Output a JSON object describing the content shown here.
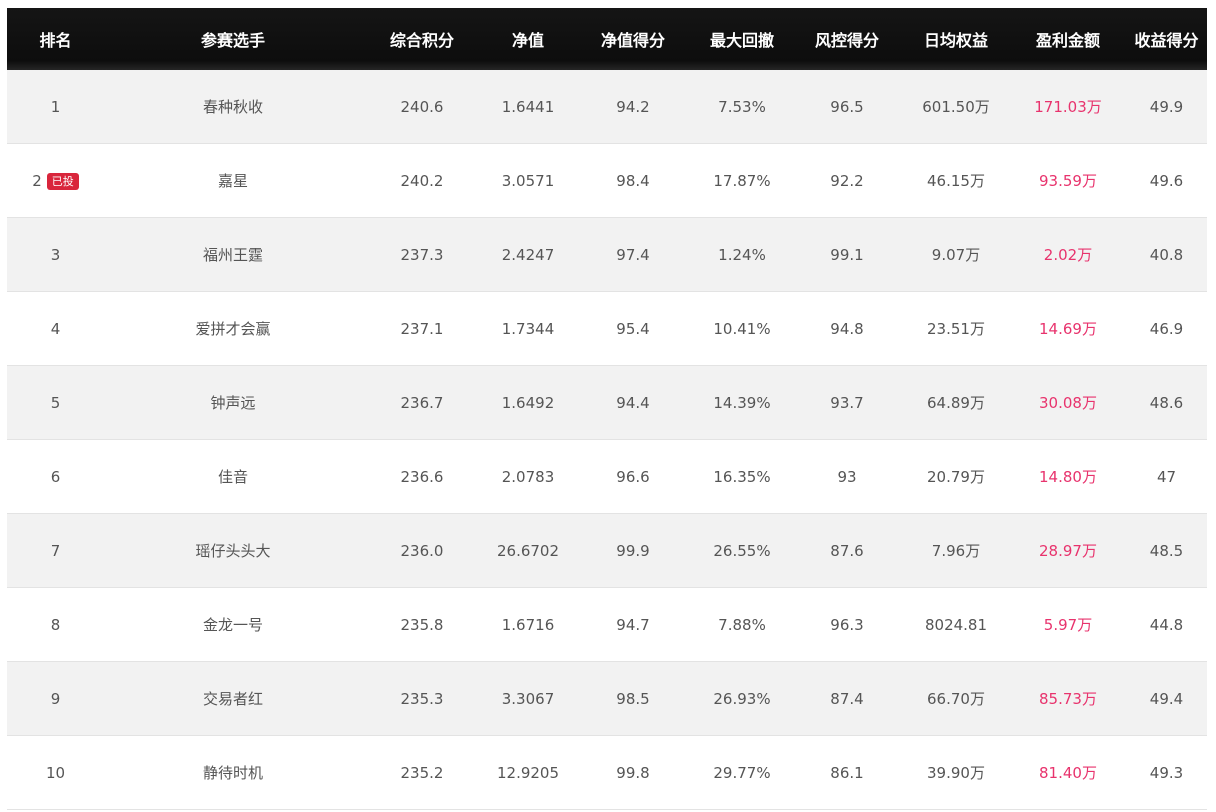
{
  "table": {
    "headers": [
      "排名",
      "参赛选手",
      "综合积分",
      "净值",
      "净值得分",
      "最大回撤",
      "风控得分",
      "日均权益",
      "盈利金额",
      "收益得分"
    ],
    "rows": [
      {
        "rank": "1",
        "badge": "",
        "player": "春种秋收",
        "score": "240.6",
        "nav": "1.6441",
        "nav_score": "94.2",
        "max_drawdown": "7.53%",
        "risk_score": "96.5",
        "avg_equity": "601.50万",
        "profit": "171.03万",
        "return_score": "49.9"
      },
      {
        "rank": "2",
        "badge": "已投",
        "player": "嘉星",
        "score": "240.2",
        "nav": "3.0571",
        "nav_score": "98.4",
        "max_drawdown": "17.87%",
        "risk_score": "92.2",
        "avg_equity": "46.15万",
        "profit": "93.59万",
        "return_score": "49.6"
      },
      {
        "rank": "3",
        "badge": "",
        "player": "福州王霆",
        "score": "237.3",
        "nav": "2.4247",
        "nav_score": "97.4",
        "max_drawdown": "1.24%",
        "risk_score": "99.1",
        "avg_equity": "9.07万",
        "profit": "2.02万",
        "return_score": "40.8"
      },
      {
        "rank": "4",
        "badge": "",
        "player": "爱拼才会赢",
        "score": "237.1",
        "nav": "1.7344",
        "nav_score": "95.4",
        "max_drawdown": "10.41%",
        "risk_score": "94.8",
        "avg_equity": "23.51万",
        "profit": "14.69万",
        "return_score": "46.9"
      },
      {
        "rank": "5",
        "badge": "",
        "player": "钟声远",
        "score": "236.7",
        "nav": "1.6492",
        "nav_score": "94.4",
        "max_drawdown": "14.39%",
        "risk_score": "93.7",
        "avg_equity": "64.89万",
        "profit": "30.08万",
        "return_score": "48.6"
      },
      {
        "rank": "6",
        "badge": "",
        "player": "佳音",
        "score": "236.6",
        "nav": "2.0783",
        "nav_score": "96.6",
        "max_drawdown": "16.35%",
        "risk_score": "93",
        "avg_equity": "20.79万",
        "profit": "14.80万",
        "return_score": "47"
      },
      {
        "rank": "7",
        "badge": "",
        "player": "瑶仔头头大",
        "score": "236.0",
        "nav": "26.6702",
        "nav_score": "99.9",
        "max_drawdown": "26.55%",
        "risk_score": "87.6",
        "avg_equity": "7.96万",
        "profit": "28.97万",
        "return_score": "48.5"
      },
      {
        "rank": "8",
        "badge": "",
        "player": "金龙一号",
        "score": "235.8",
        "nav": "1.6716",
        "nav_score": "94.7",
        "max_drawdown": "7.88%",
        "risk_score": "96.3",
        "avg_equity": "8024.81",
        "profit": "5.97万",
        "return_score": "44.8"
      },
      {
        "rank": "9",
        "badge": "",
        "player": "交易者红",
        "score": "235.3",
        "nav": "3.3067",
        "nav_score": "98.5",
        "max_drawdown": "26.93%",
        "risk_score": "87.4",
        "avg_equity": "66.70万",
        "profit": "85.73万",
        "return_score": "49.4"
      },
      {
        "rank": "10",
        "badge": "",
        "player": "静待时机",
        "score": "235.2",
        "nav": "12.9205",
        "nav_score": "99.8",
        "max_drawdown": "29.77%",
        "risk_score": "86.1",
        "avg_equity": "39.90万",
        "profit": "81.40万",
        "return_score": "49.3"
      }
    ]
  },
  "colors": {
    "header_bg": "#111111",
    "header_text": "#ffffff",
    "row_alt_bg": "#f2f2f2",
    "text": "#555555",
    "profit": "#e8336d",
    "badge_bg": "#d9263c"
  }
}
